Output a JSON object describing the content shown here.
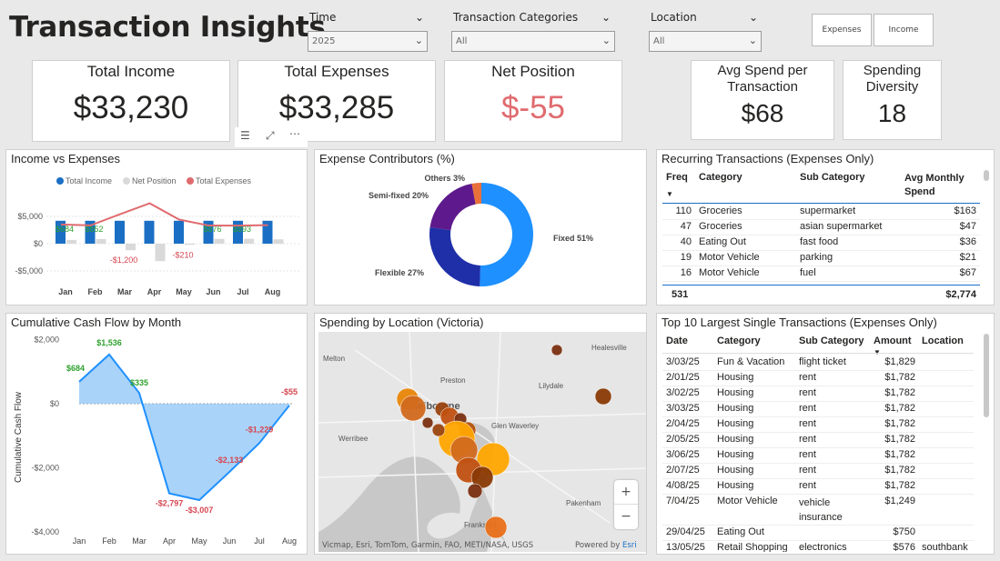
{
  "title": "Transaction Insights",
  "slicers": {
    "time": {
      "label": "Time",
      "value": "2025"
    },
    "categories": {
      "label": "Transaction Categories",
      "value": "All"
    },
    "location": {
      "label": "Location",
      "value": "All"
    }
  },
  "toggles": {
    "expenses": "Expenses",
    "income": "Income"
  },
  "cards": {
    "total_income": {
      "label": "Total Income",
      "value": "$33,230"
    },
    "total_expenses": {
      "label": "Total Expenses",
      "value": "$33,285"
    },
    "net_position": {
      "label": "Net Position",
      "value": "$-55"
    },
    "avg_spend": {
      "label": "Avg Spend per Transaction",
      "value": "$68"
    },
    "diversity": {
      "label": "Spending Diversity",
      "value": "18"
    }
  },
  "colors": {
    "income": "#1a6fc4",
    "net": "#d9d9d9",
    "expenses": "#e06b6f",
    "negative": "#d64550",
    "positive": "#2ea02e",
    "fixed": "#1e90ff",
    "flexible": "#1f2fa8",
    "semifixed": "#5e1a8c",
    "others": "#e8703a"
  },
  "chart_data": [
    {
      "type": "bar",
      "title": "Income vs Expenses",
      "categories": [
        "Jan",
        "Feb",
        "Mar",
        "Apr",
        "May",
        "Jun",
        "Jul",
        "Aug"
      ],
      "series": [
        {
          "name": "Total Income",
          "values": [
            4200,
            4200,
            4200,
            4200,
            4200,
            4200,
            4200,
            4200
          ]
        },
        {
          "name": "Net Position",
          "values": [
            684,
            852,
            -1200,
            -3200,
            -210,
            876,
            893,
            800
          ]
        },
        {
          "name": "Total Expenses",
          "values": [
            3516,
            3348,
            5400,
            7400,
            4410,
            3324,
            3307,
            3400
          ]
        }
      ],
      "data_labels": [
        "$684",
        "$852",
        "-$1,200",
        "",
        "-$210",
        "$876",
        "$893",
        ""
      ],
      "yticks": [
        "$5,000",
        "$0",
        "-$5,000"
      ],
      "ylim": [
        -6000,
        8000
      ]
    },
    {
      "type": "pie",
      "title": "Expense Contributors (%)",
      "categories": [
        "Fixed",
        "Flexible",
        "Semi-fixed",
        "Others"
      ],
      "values": [
        51,
        27,
        20,
        3
      ],
      "labels": [
        "Fixed 51%",
        "Flexible 27%",
        "Semi-fixed 20%",
        "Others 3%"
      ]
    },
    {
      "type": "area",
      "title": "Cumulative Cash Flow by Month",
      "ylabel": "Cumulative Cash Flow",
      "categories": [
        "Jan",
        "Feb",
        "Mar",
        "Apr",
        "May",
        "Jun",
        "Jul",
        "Aug"
      ],
      "values": [
        684,
        1536,
        335,
        -2797,
        -3007,
        -2133,
        -1229,
        -55
      ],
      "data_labels": [
        "$684",
        "$1,536",
        "$335",
        "-$2,797",
        "-$3,007",
        "-$2,133",
        "-$1,229",
        "-$55"
      ],
      "yticks": [
        "$2,000",
        "$0",
        "-$2,000",
        "-$4,000"
      ],
      "ylim": [
        -4000,
        2000
      ]
    }
  ],
  "recurring": {
    "title": "Recurring Transactions (Expenses Only)",
    "headers": {
      "freq": "Freq",
      "category": "Category",
      "sub": "Sub Category",
      "avg": "Avg Monthly Spend"
    },
    "rows": [
      {
        "freq": "110",
        "category": "Groceries",
        "sub": "supermarket",
        "avg": "$163"
      },
      {
        "freq": "47",
        "category": "Groceries",
        "sub": "asian supermarket",
        "avg": "$47"
      },
      {
        "freq": "40",
        "category": "Eating Out",
        "sub": "fast food",
        "avg": "$36"
      },
      {
        "freq": "19",
        "category": "Motor Vehicle",
        "sub": "parking",
        "avg": "$21"
      },
      {
        "freq": "16",
        "category": "Motor Vehicle",
        "sub": "fuel",
        "avg": "$67"
      }
    ],
    "total": {
      "freq": "531",
      "avg": "$2,774"
    }
  },
  "map": {
    "title": "Spending by Location (Victoria)",
    "places": [
      "Melton",
      "Preston",
      "Healesville",
      "Lilydale",
      "Melbourne",
      "Glen Waverley",
      "Werribee",
      "Pakenham",
      "Frankston"
    ],
    "attribution": "Vicmap, Esri, TomTom, Garmin, FAO, METI/NASA, USGS",
    "powered": "Powered by",
    "esri": "Esri",
    "zoom_in": "+",
    "zoom_out": "−"
  },
  "top10": {
    "title": "Top 10 Largest Single Transactions (Expenses Only)",
    "headers": {
      "date": "Date",
      "category": "Category",
      "sub": "Sub Category",
      "amount": "Amount",
      "location": "Location"
    },
    "rows": [
      {
        "date": "3/03/25",
        "category": "Fun & Vacation",
        "sub": "flight ticket",
        "amount": "$1,829",
        "location": ""
      },
      {
        "date": "2/01/25",
        "category": "Housing",
        "sub": "rent",
        "amount": "$1,782",
        "location": ""
      },
      {
        "date": "3/02/25",
        "category": "Housing",
        "sub": "rent",
        "amount": "$1,782",
        "location": ""
      },
      {
        "date": "3/03/25",
        "category": "Housing",
        "sub": "rent",
        "amount": "$1,782",
        "location": ""
      },
      {
        "date": "2/04/25",
        "category": "Housing",
        "sub": "rent",
        "amount": "$1,782",
        "location": ""
      },
      {
        "date": "2/05/25",
        "category": "Housing",
        "sub": "rent",
        "amount": "$1,782",
        "location": ""
      },
      {
        "date": "3/06/25",
        "category": "Housing",
        "sub": "rent",
        "amount": "$1,782",
        "location": ""
      },
      {
        "date": "2/07/25",
        "category": "Housing",
        "sub": "rent",
        "amount": "$1,782",
        "location": ""
      },
      {
        "date": "4/08/25",
        "category": "Housing",
        "sub": "rent",
        "amount": "$1,782",
        "location": ""
      },
      {
        "date": "7/04/25",
        "category": "Motor Vehicle",
        "sub": "vehicle insurance",
        "amount": "$1,249",
        "location": ""
      },
      {
        "date": "29/04/25",
        "category": "Eating Out",
        "sub": "",
        "amount": "$750",
        "location": ""
      },
      {
        "date": "13/05/25",
        "category": "Retail Shopping",
        "sub": "electronics",
        "amount": "$576",
        "location": "southbank"
      }
    ]
  }
}
